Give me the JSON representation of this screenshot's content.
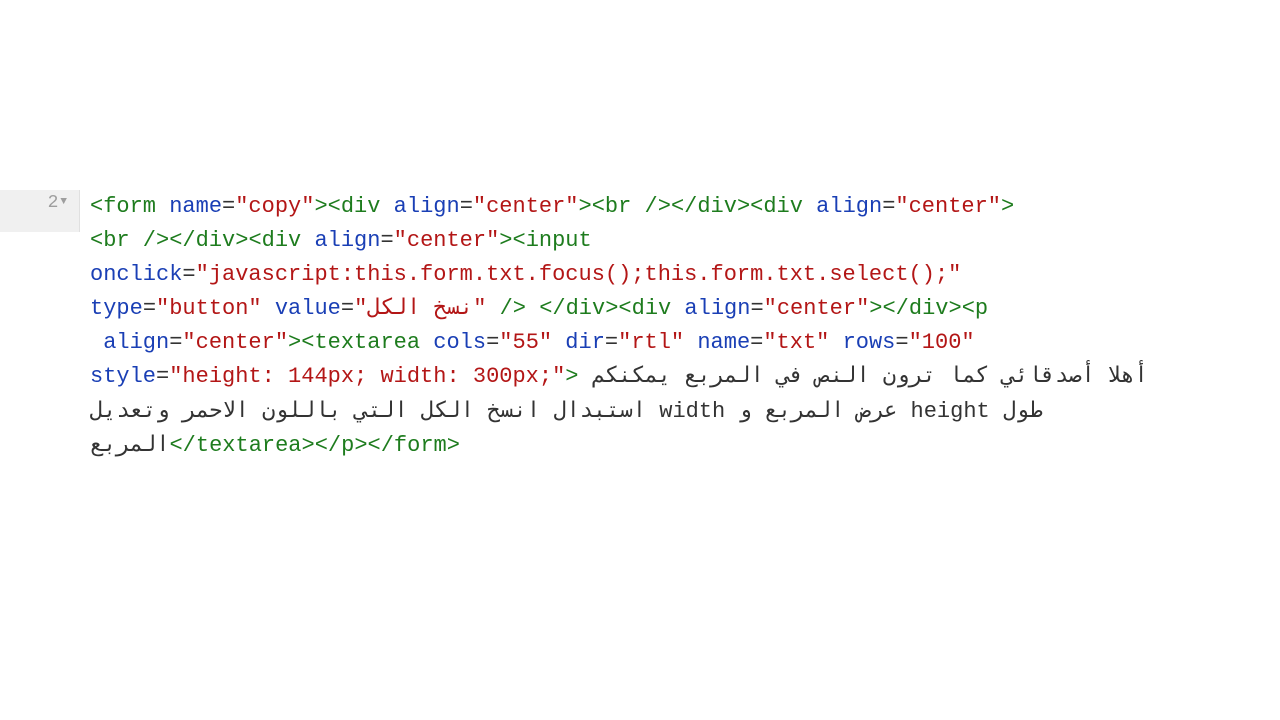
{
  "gutter": {
    "line2": "2"
  },
  "tok": {
    "t0": "<form",
    "a0": " name",
    "eq": "=",
    "v0": "\"copy\"",
    "t0c": ">",
    "t1": "<div",
    "a1": " align",
    "v1": "\"center\"",
    "t1c": ">",
    "br": "<br />",
    "divc": "</div>",
    "t2": "<div",
    "t3": "<div",
    "t4": "<input",
    "nl": "\n",
    "a2": "onclick",
    "v2": "\"javascript:this.form.txt.focus();this.form.txt.select();\"",
    "a3": "type",
    "v3": "\"button\"",
    "a4": " value",
    "v4a": "\"",
    "v4b": "نسخ الكل",
    "v4c": "\"",
    "t4c": " />",
    "sp": " ",
    "t5": "<div",
    "t6": "<p",
    "t7": "<textarea",
    "a5": " cols",
    "v5": "\"55\"",
    "a6": " dir",
    "v6": "\"rtl\"",
    "a7": " name",
    "v7": "\"txt\"",
    "a8": " rows",
    "v8": "\"100\"",
    "a9": "style",
    "v9": "\"height: 144px; width: 300px;\"",
    "t7c": ">",
    "content": " أهلا أصدقائي كما ترون النص في المربع يمكنكم استبدال انسخ الكل التي باللون الاحمر وتعديل width عرض المربع و height طول المربع",
    "ct7": "</textarea>",
    "ct6": "</p>",
    "ct0": "</form>"
  }
}
